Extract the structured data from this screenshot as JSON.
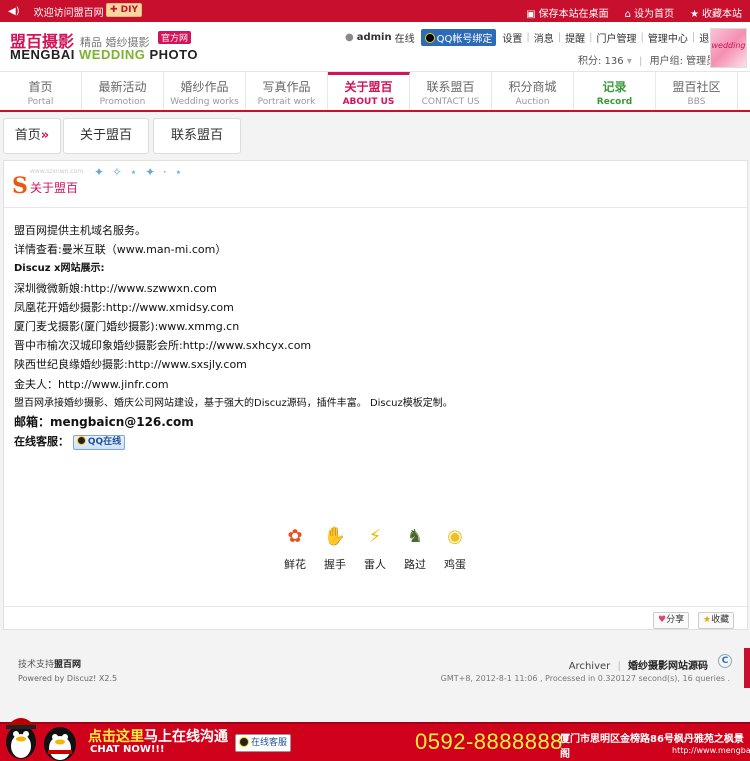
{
  "topbar": {
    "welcome": "欢迎访问盟百网",
    "diy": "DIY",
    "links": [
      {
        "icon": "desktop-icon",
        "label": "保存本站在桌面"
      },
      {
        "icon": "home-icon",
        "label": "设为首页"
      },
      {
        "icon": "star-icon",
        "label": "收藏本站"
      }
    ]
  },
  "header": {
    "logo_cn": "盟百摄影",
    "logo_sub": "精品 婚纱摄影",
    "logo_tag": "官方网",
    "logo_en_1": "MENGBAI",
    "logo_en_2": "WEDDING",
    "logo_en_3": "PHOTO",
    "user": {
      "name": "admin",
      "status": "在线",
      "qq_bind": "QQ帐号绑定",
      "menu": [
        "设置",
        "消息",
        "提醒",
        "门户管理",
        "管理中心",
        "退出"
      ]
    },
    "credits": "积分: 136",
    "group": "用户组: 管理员",
    "avatar_text": "wedding"
  },
  "nav": [
    {
      "cn": "首页",
      "en": "Portal",
      "state": "normal"
    },
    {
      "cn": "最新活动",
      "en": "Promotion",
      "state": "normal"
    },
    {
      "cn": "婚纱作品",
      "en": "Wedding works",
      "state": "normal"
    },
    {
      "cn": "写真作品",
      "en": "Portrait work",
      "state": "normal"
    },
    {
      "cn": "关于盟百",
      "en": "ABOUT US",
      "state": "active"
    },
    {
      "cn": "联系盟百",
      "en": "CONTACT US",
      "state": "normal"
    },
    {
      "cn": "积分商城",
      "en": "Auction",
      "state": "normal"
    },
    {
      "cn": "记录",
      "en": "Record",
      "state": "record"
    },
    {
      "cn": "盟百社区",
      "en": "BBS",
      "state": "normal"
    }
  ],
  "tabs": {
    "home": "首页",
    "home_arrow": "»",
    "about": "关于盟百",
    "contact": "联系盟百"
  },
  "panel": {
    "title_s": "S",
    "title": "关于盟百",
    "watermark": "www.szxnwn.com",
    "lines": [
      "盟百网提供主机域名服务。",
      "详情查看:曼米互联（www.man-mi.com）",
      "Discuz x网站展示:",
      "深圳微微新娘:http://www.szwwxn.com",
      "凤凰花开婚纱摄影:http://www.xmidsy.com",
      "厦门麦戈摄影(厦门婚纱摄影):www.xmmg.cn",
      "晋中市榆次汉城印象婚纱摄影会所:http://www.sxhcyx.com",
      "陕西世纪良缘婚纱摄影:http://www.sxsjly.com",
      "金夫人：http://www.jinfr.com",
      "盟百网承接婚纱摄影、婚庆公司网站建设，基于强大的Discuz源码，插件丰富。 Discuz模板定制。",
      "邮箱：mengbaicn@126.com",
      "在线客服："
    ],
    "qq_online": "QQ在线",
    "reactions": [
      {
        "icon": "flower-icon",
        "glyph": "✿",
        "color": "#e8501c",
        "label": "鲜花"
      },
      {
        "icon": "handshake-icon",
        "glyph": "✋",
        "color": "#d8a070",
        "label": "握手"
      },
      {
        "icon": "lightning-icon",
        "glyph": "⚡",
        "color": "#f0b800",
        "label": "雷人"
      },
      {
        "icon": "soldier-icon",
        "glyph": "♞",
        "color": "#4a6a2a",
        "label": "路过"
      },
      {
        "icon": "egg-icon",
        "glyph": "◉",
        "color": "#f0c020",
        "label": "鸡蛋"
      }
    ],
    "share": "分享",
    "favorite": "收藏"
  },
  "footer": {
    "support_prefix": "技术支持",
    "support_name": "盟百网",
    "powered": "Powered by Discuz! X2.5",
    "archiver": "Archiver",
    "source": "婚纱摄影网站源码",
    "stats": "GMT+8, 2012-8-1 11:06 , Processed in 0.320127 second(s), 16 queries ."
  },
  "chatbar": {
    "cta_yellow": "点击这里",
    "cta_white": "马上在线沟通",
    "cta_en": "CHAT NOW!!!",
    "service": "在线客服",
    "phone": "0592-8888888",
    "address": "厦门市思明区金榜路86号枫丹雅苑之枫景阁",
    "url": "http://www.mengbai.cn"
  }
}
